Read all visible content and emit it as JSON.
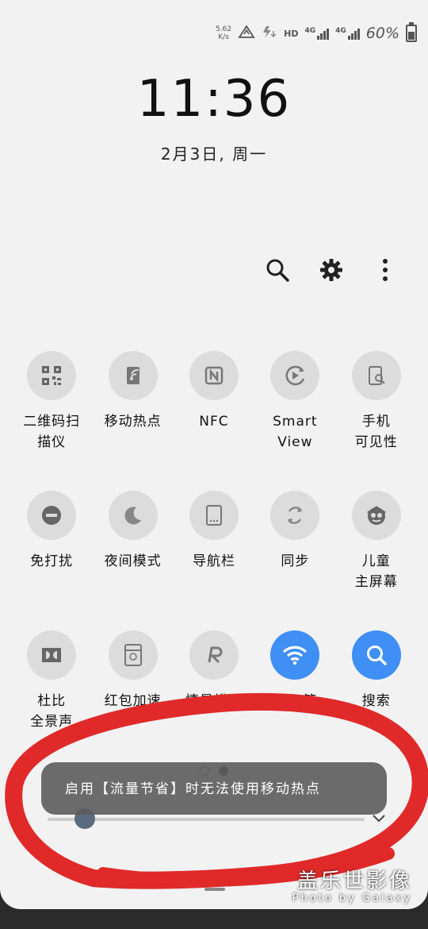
{
  "status_bar": {
    "net_speed_value": "5.62",
    "net_speed_unit": "K/s",
    "hd_label": "HD",
    "net1_label": "4G",
    "net2_label": "4G",
    "battery_text": "60%",
    "battery_level_fraction": 0.6
  },
  "clock": {
    "time": "11:36",
    "date": "2月3日, 周一"
  },
  "quick_panel": {
    "tiles": [
      {
        "label": "二维码扫\n描仪",
        "icon": "qr-code-icon",
        "active": false
      },
      {
        "label": "移动热点",
        "icon": "mobile-hotspot-icon",
        "active": false
      },
      {
        "label": "NFC",
        "icon": "nfc-icon",
        "active": false
      },
      {
        "label": "Smart\nView",
        "icon": "smart-view-icon",
        "active": false
      },
      {
        "label": "手机\n可见性",
        "icon": "phone-visibility-icon",
        "active": false
      },
      {
        "label": "免打扰",
        "icon": "do-not-disturb-icon",
        "active": false
      },
      {
        "label": "夜间模式",
        "icon": "moon-icon",
        "active": false
      },
      {
        "label": "导航栏",
        "icon": "navigation-bar-icon",
        "active": false
      },
      {
        "label": "同步",
        "icon": "sync-icon",
        "active": false
      },
      {
        "label": "儿童\n主屏幕",
        "icon": "kids-icon",
        "active": false
      },
      {
        "label": "杜比\n全景声",
        "icon": "dolby-icon",
        "active": false
      },
      {
        "label": "红包加速",
        "icon": "red-envelope-icon",
        "active": false
      },
      {
        "label": "情景模式",
        "icon": "scene-mode-icon",
        "active": false
      },
      {
        "label": "WiFi管",
        "icon": "wifi-icon",
        "active": true
      },
      {
        "label": "搜索",
        "icon": "search-icon",
        "active": true
      }
    ],
    "pager": {
      "pages": 2,
      "current": 2
    },
    "brightness_fraction": 0.1
  },
  "toast": {
    "message": "启用【流量节省】时无法使用移动热点"
  },
  "watermark": {
    "title": "盖乐世影像",
    "subtitle": "Photo by Galaxy"
  },
  "colors": {
    "accent": "#3f8ff4",
    "tile_bg": "#dcdcdc",
    "annotation": "#e02a2a"
  }
}
